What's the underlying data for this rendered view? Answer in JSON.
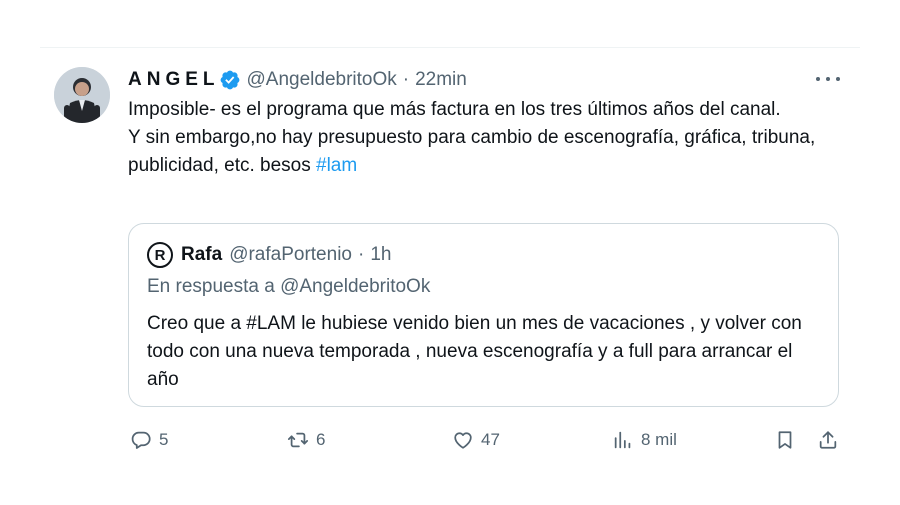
{
  "tweet": {
    "author_name": "ANGEL",
    "handle": "@AngeldebritoOk",
    "separator": "·",
    "time": "22min",
    "text_line1": "Imposible- es el programa que más factura en los tres últimos años del canal.",
    "text_line2_prefix": "Y sin embargo,no hay presupuesto para cambio de escenografía, gráfica, tribuna, publicidad, etc. besos ",
    "hashtag": "#lam"
  },
  "quote": {
    "avatar_letter": "R",
    "name": "Rafa",
    "handle": "@rafaPortenio",
    "separator": "·",
    "time": "1h",
    "reply_to": "En respuesta a @AngeldebritoOk",
    "text": "Creo que a #LAM le hubiese venido bien un mes de vacaciones , y volver con todo con una nueva temporada , nueva escenografía y a full para arrancar el año"
  },
  "actions": {
    "replies": "5",
    "reposts": "6",
    "likes": "47",
    "views": "8 mil"
  },
  "icons": {
    "verified": "verified-badge-icon",
    "more": "more-options-icon",
    "reply": "reply-bubble-icon",
    "repost": "repost-icon",
    "like": "heart-icon",
    "views": "views-chart-icon",
    "bookmark": "bookmark-icon",
    "share": "share-icon"
  },
  "colors": {
    "link": "#1d9bf0",
    "secondary_text": "#536471",
    "primary_text": "#0f1419",
    "border": "#cfd9de"
  }
}
